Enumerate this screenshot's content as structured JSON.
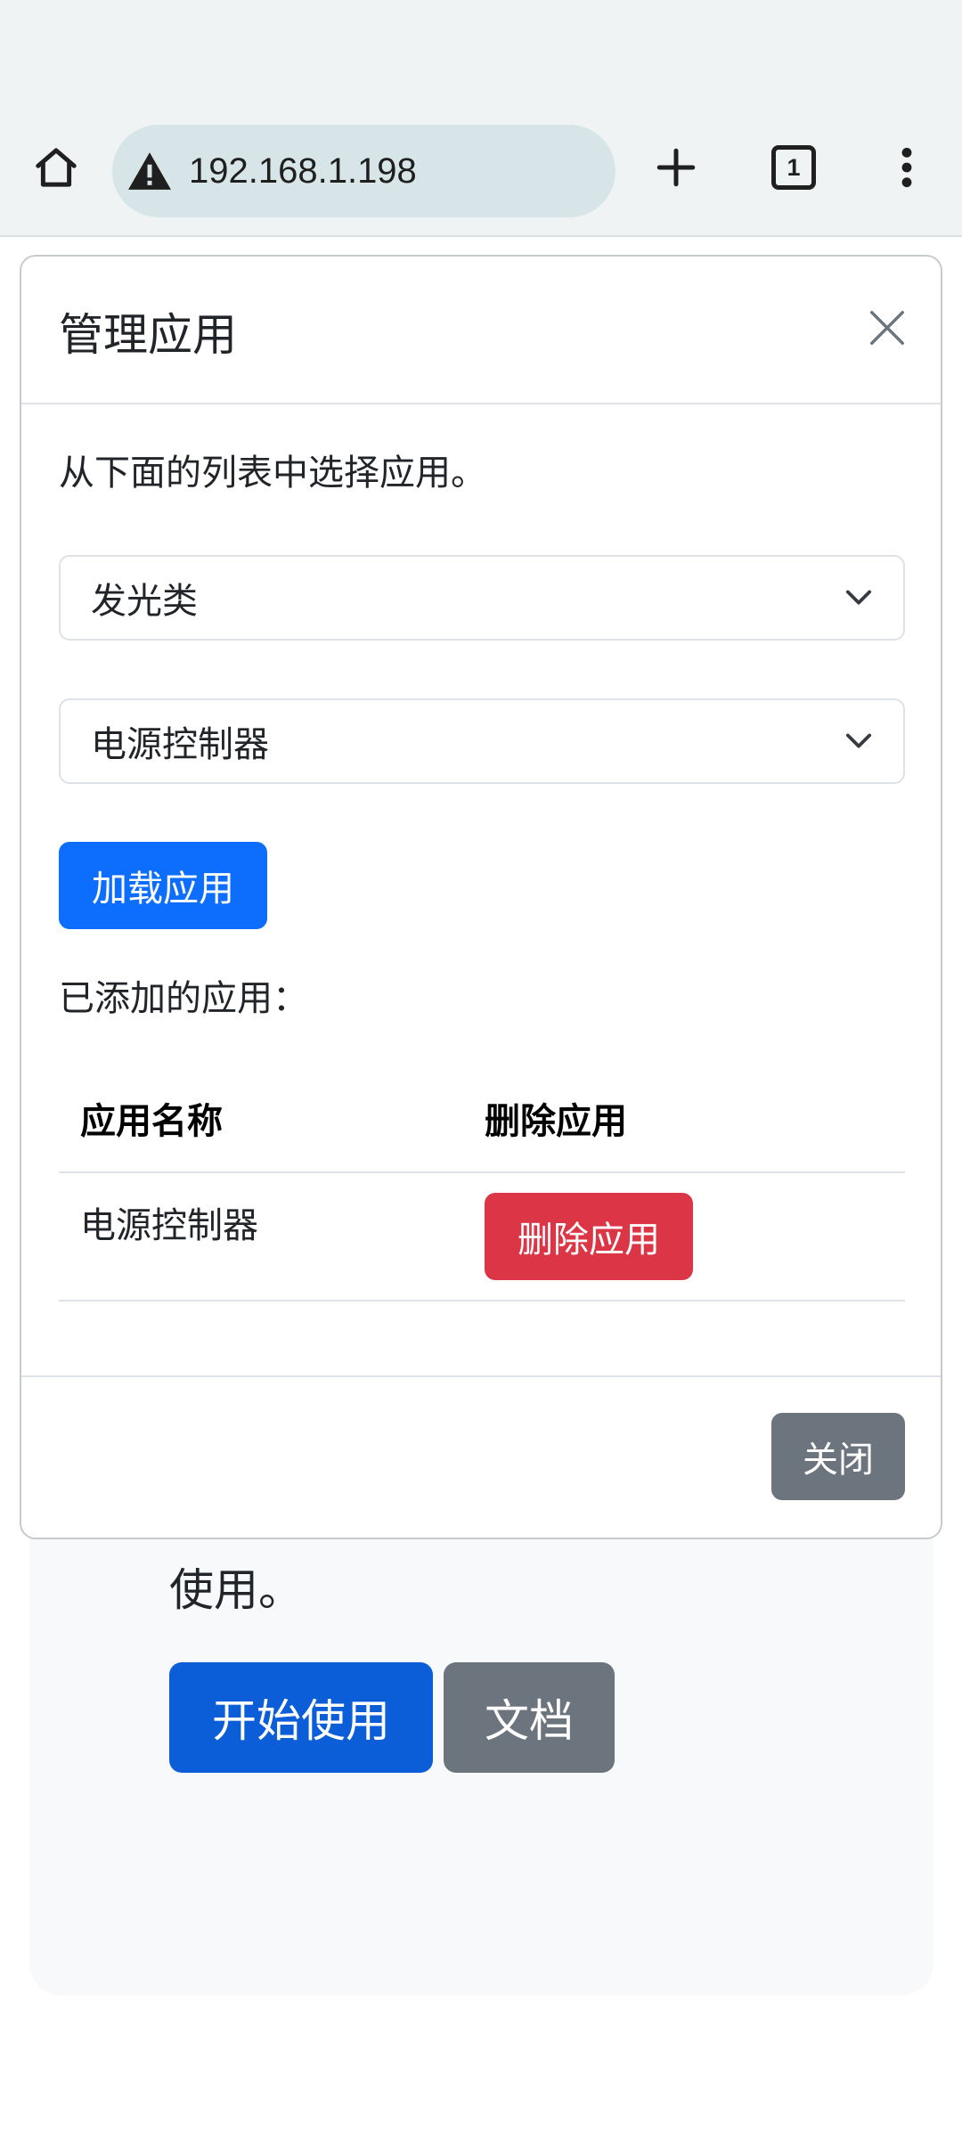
{
  "browser": {
    "url": "192.168.1.198",
    "tab_count": "1",
    "icons": {
      "home": "home-icon",
      "warning": "warning-icon",
      "new_tab": "plus-icon",
      "menu": "more-vert-icon"
    }
  },
  "modal": {
    "title": "管理应用",
    "intro": "从下面的列表中选择应用。",
    "category_select": {
      "value": "发光类"
    },
    "app_select": {
      "value": "电源控制器"
    },
    "load_button": "加载应用",
    "added_label": "已添加的应用：",
    "table": {
      "headers": [
        "应用名称",
        "删除应用"
      ],
      "rows": [
        {
          "name": "电源控制器",
          "action": "删除应用"
        }
      ]
    },
    "close_button": "关闭"
  },
  "page": {
    "hero_text": "使用。",
    "start_button": "开始使用",
    "docs_button": "文档"
  },
  "colors": {
    "primary": "#0d6efd",
    "danger": "#dc3545",
    "secondary": "#6c757d",
    "chrome": "#eff3f4",
    "url_bar": "#d8e5e8"
  }
}
